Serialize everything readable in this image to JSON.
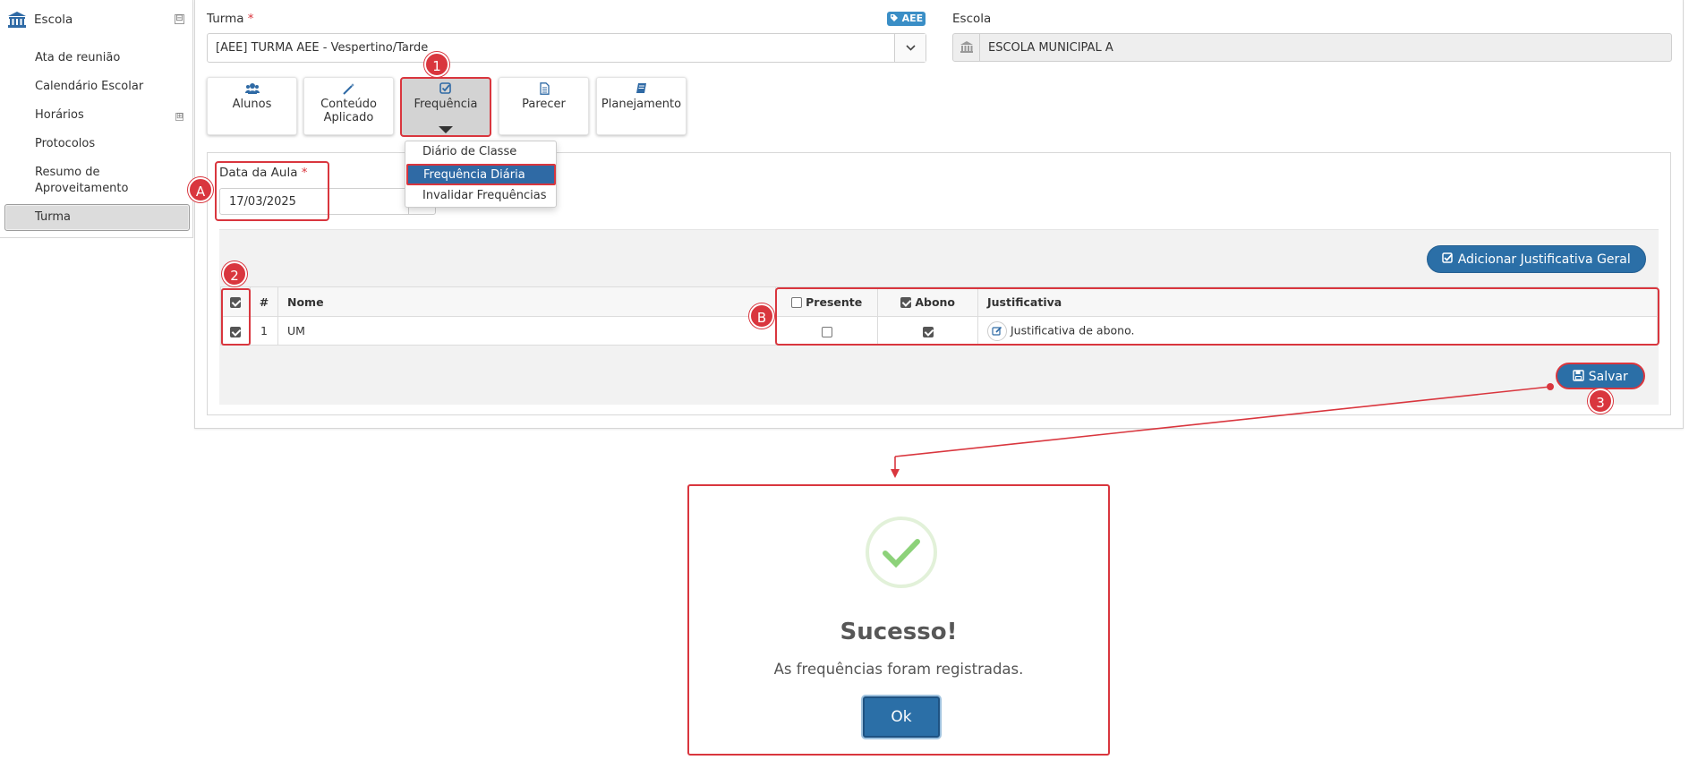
{
  "sidebar": {
    "header": "Escola",
    "collapse_symbol": "⊟",
    "expand_symbol": "⊞",
    "items": [
      "Ata de reunião",
      "Calendário Escolar",
      "Horários",
      "Protocolos",
      "Resumo de",
      "Aproveitamento",
      "Turma"
    ]
  },
  "form": {
    "turma_label": "Turma",
    "required_mark": "*",
    "aee_tag": "AEE",
    "turma_value": "[AEE]  TURMA AEE - Vespertino/Tarde",
    "escola_label": "Escola",
    "escola_value": "ESCOLA MUNICIPAL A",
    "date_label": "Data da Aula",
    "date_value": "17/03/2025"
  },
  "tiles": {
    "alunos": "Alunos",
    "conteudo_1": "Conteúdo",
    "conteudo_2": "Aplicado",
    "frequencia": "Frequência",
    "parecer": "Parecer",
    "planejamento": "Planejamento"
  },
  "dropdown": {
    "items": [
      "Diário de Classe",
      "Frequência Diária",
      "Invalidar Frequências"
    ]
  },
  "buttons": {
    "add_justification": "Adicionar Justificativa Geral",
    "save": "Salvar"
  },
  "table": {
    "headers": {
      "num": "#",
      "name": "Nome",
      "present": "Presente",
      "abono": "Abono",
      "justification": "Justificativa"
    },
    "rows": [
      {
        "num": "1",
        "name": "UM",
        "present": false,
        "abono": true,
        "justification": "Justificativa de abono."
      }
    ]
  },
  "annotations": {
    "one": "1",
    "two": "2",
    "three": "3",
    "a": "A",
    "b": "B"
  },
  "modal": {
    "title": "Sucesso!",
    "message": "As frequências foram registradas.",
    "ok": "Ok"
  },
  "colors": {
    "primary": "#2b6fa7",
    "highlight": "#d9363e",
    "success": "#8dd27a"
  },
  "icons": [
    "institution-icon",
    "users-icon",
    "magic-icon",
    "check-square-icon",
    "file-text-icon",
    "book-icon",
    "tag-icon",
    "chevron-down-icon",
    "edit-icon",
    "save-icon",
    "check-icon"
  ]
}
